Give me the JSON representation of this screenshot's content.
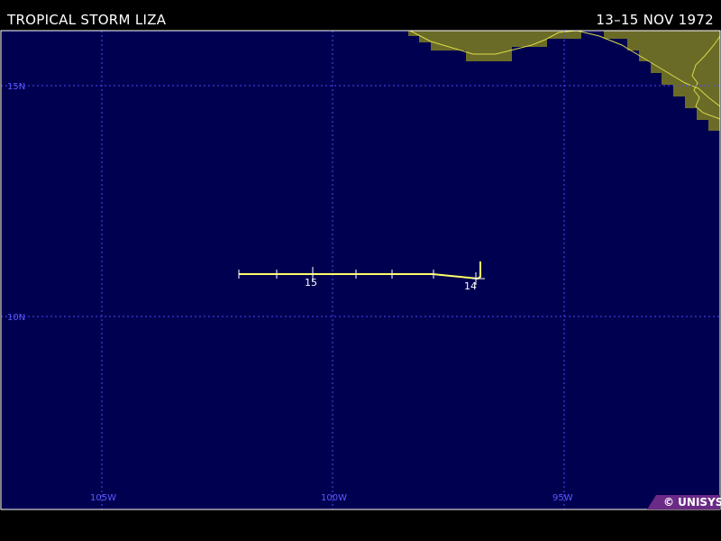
{
  "header": {
    "title": "TROPICAL STORM LIZA",
    "dates": "13–15 NOV 1972"
  },
  "map": {
    "ocean_color": "#000050",
    "land_color": "#6b6b28",
    "coast_color": "#d9d94a",
    "grid_color": "#4a4aff",
    "track_color": "#ffff66",
    "lat_labels": [
      "15N",
      "10N"
    ],
    "lon_labels": [
      "105W",
      "100W",
      "95W"
    ],
    "day_labels": [
      "15",
      "14"
    ]
  },
  "credit": "© UNISYS"
}
